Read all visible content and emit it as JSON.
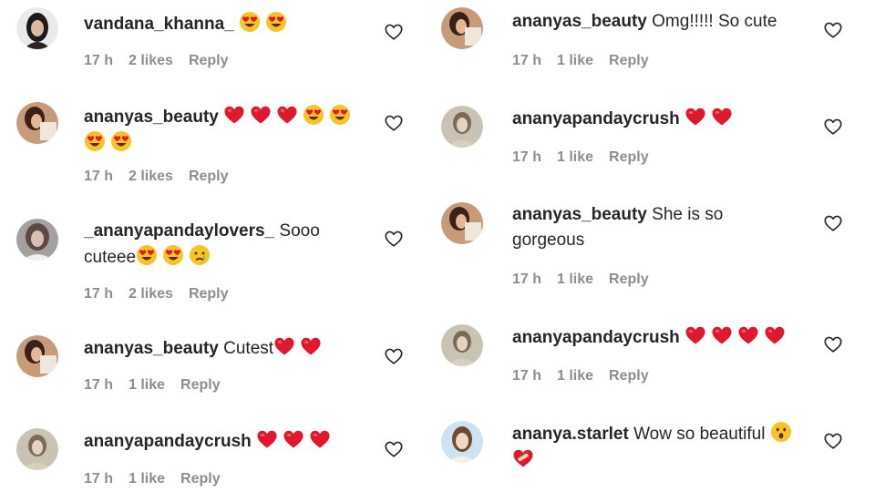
{
  "columns": [
    {
      "comments": [
        {
          "username": "vandana_khanna_",
          "text": "",
          "emojis": [
            "heart-eyes",
            "heart-eyes"
          ],
          "time": "17 h",
          "likes": "2 likes",
          "reply": "Reply",
          "avatar": "dark-hair"
        },
        {
          "username": "ananyas_beauty",
          "text": "",
          "emojis": [
            "red-heart",
            "red-heart",
            "red-heart",
            "heart-eyes",
            "heart-eyes",
            "heart-eyes",
            "heart-eyes"
          ],
          "time": "17 h",
          "likes": "2 likes",
          "reply": "Reply",
          "avatar": "brown"
        },
        {
          "username": "_ananyapandaylovers_",
          "text": "Sooo cuteee",
          "emojis": [
            "heart-eyes",
            "heart-eyes",
            "crying-face"
          ],
          "time": "17 h",
          "likes": "2 likes",
          "reply": "Reply",
          "avatar": "grey"
        },
        {
          "username": "ananyas_beauty",
          "text": "Cutest",
          "emojis": [
            "red-heart",
            "red-heart"
          ],
          "time": "17 h",
          "likes": "1 like",
          "reply": "Reply",
          "avatar": "brown"
        },
        {
          "username": "ananyapandaycrush",
          "text": "",
          "emojis": [
            "red-heart",
            "red-heart",
            "red-heart"
          ],
          "time": "17 h",
          "likes": "1 like",
          "reply": "Reply",
          "avatar": "beige"
        }
      ]
    },
    {
      "comments": [
        {
          "username": "ananyas_beauty",
          "text": "Omg!!!!! So cute",
          "emojis": [],
          "time": "17 h",
          "likes": "1 like",
          "reply": "Reply",
          "avatar": "brown"
        },
        {
          "username": "ananyapandaycrush",
          "text": "",
          "emojis": [
            "red-heart",
            "red-heart"
          ],
          "time": "17 h",
          "likes": "1 like",
          "reply": "Reply",
          "avatar": "beige"
        },
        {
          "username": "ananyas_beauty",
          "text": "She is so gorgeous",
          "emojis": [],
          "time": "17 h",
          "likes": "1 like",
          "reply": "Reply",
          "avatar": "brown"
        },
        {
          "username": "ananyapandaycrush",
          "text": "",
          "emojis": [
            "red-heart",
            "red-heart",
            "red-heart",
            "red-heart"
          ],
          "time": "17 h",
          "likes": "1 like",
          "reply": "Reply",
          "avatar": "beige"
        },
        {
          "username": "ananya.starlet",
          "text": "Wow so beautiful",
          "emojis": [
            "astonished-face",
            "mending-heart"
          ],
          "time": "",
          "likes": "",
          "reply": "",
          "avatar": "light-blue"
        }
      ]
    }
  ],
  "icons": {
    "like": "heart-outline-icon"
  },
  "colors": {
    "meta": "#8e8e8e",
    "text": "#262626",
    "heart": "#e0182d",
    "emoji_face": "#f7c325"
  }
}
